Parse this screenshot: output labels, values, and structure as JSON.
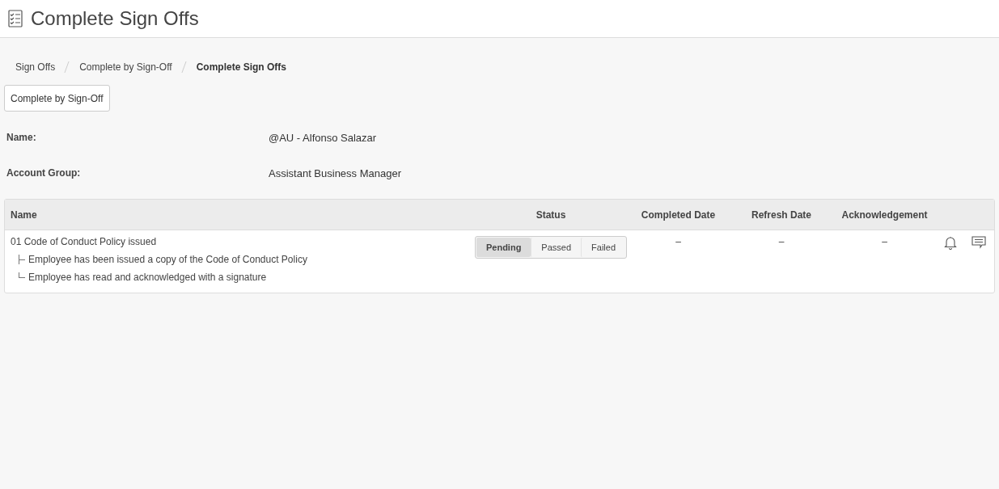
{
  "page": {
    "title": "Complete Sign Offs"
  },
  "breadcrumb": [
    {
      "label": "Sign Offs",
      "current": false
    },
    {
      "label": "Complete by Sign-Off",
      "current": false
    },
    {
      "label": "Complete Sign Offs",
      "current": true
    }
  ],
  "back_button": {
    "label": "Complete by Sign-Off"
  },
  "details": [
    {
      "label": "Name:",
      "value": "@AU - Alfonso Salazar"
    },
    {
      "label": "Account Group:",
      "value": "Assistant Business Manager"
    }
  ],
  "table": {
    "columns": [
      "Name",
      "Status",
      "Completed Date",
      "Refresh Date",
      "Acknowledgement"
    ],
    "rows": [
      {
        "name": "01 Code of Conduct Policy issued",
        "children": [
          {
            "text": "Employee has been issued a copy of the Code of Conduct Policy"
          },
          {
            "text": "Employee has read and acknowledged with a signature"
          }
        ],
        "status_options": [
          {
            "label": "Pending",
            "selected": true
          },
          {
            "label": "Passed",
            "selected": false
          },
          {
            "label": "Failed",
            "selected": false
          }
        ],
        "completed_date": "–",
        "refresh_date": "–",
        "acknowledgement": "–"
      }
    ]
  }
}
